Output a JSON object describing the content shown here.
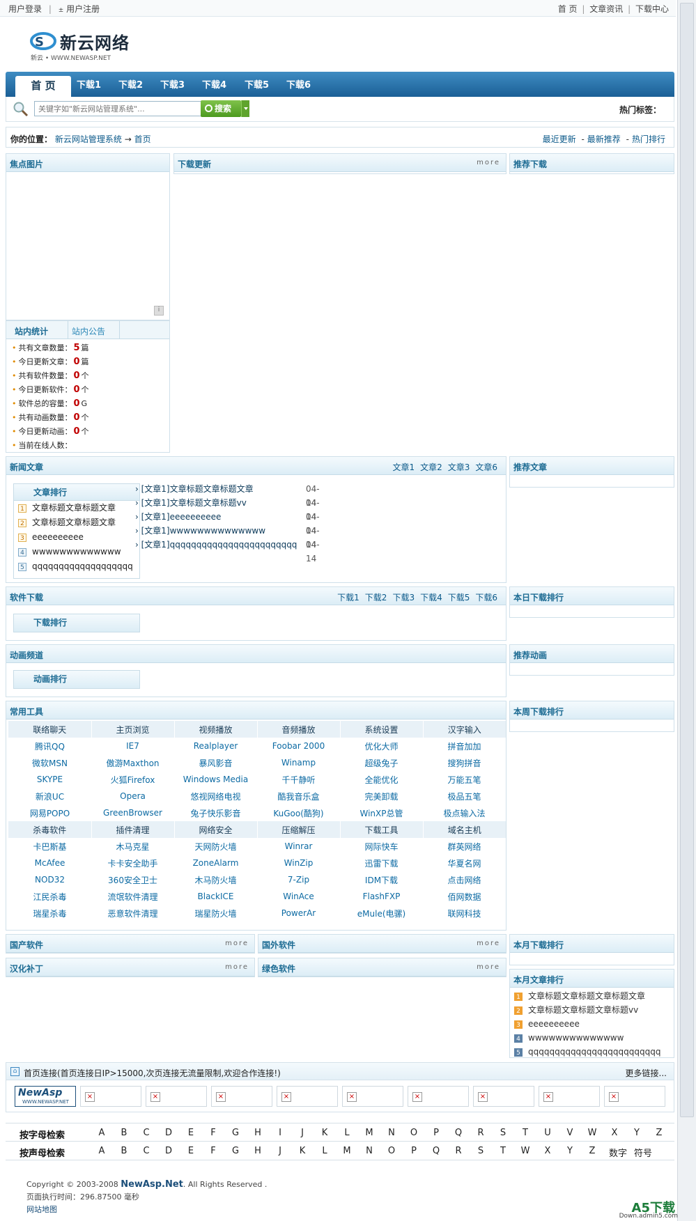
{
  "topbar": {
    "login": "用户登录",
    "register": "用户注册",
    "right": [
      "首 页",
      "文章资讯",
      "下载中心"
    ]
  },
  "logo": {
    "title": "新云网络",
    "sub": "新云 • WWW.NEWASP.NET"
  },
  "nav": {
    "home": "首 页",
    "tabs": [
      "下载1",
      "下载2",
      "下载3",
      "下载4",
      "下载5",
      "下载6"
    ]
  },
  "search": {
    "placeholder": "关键字如\"新云网站管理系统\"...",
    "button": "搜索",
    "hot": "热门标签："
  },
  "crumb": {
    "label": "你的位置：",
    "path": "新云网站管理系统",
    "arrow": "→",
    "current": "首页",
    "right": [
      "最近更新",
      "最新推荐",
      "热门排行"
    ]
  },
  "panels": {
    "focus": "焦点图片",
    "dl_update": "下载更新",
    "recommend_dl": "推荐下载",
    "more": "more",
    "stat_tab": "站内统计",
    "notice_tab": "站内公告",
    "news": "新闻文章",
    "rec_article": "推荐文章",
    "software": "软件下载",
    "today_rank": "本日下载排行",
    "anim": "动画频道",
    "rec_anim": "推荐动画",
    "tools": "常用工具",
    "week_rank": "本周下载排行",
    "domestic": "国产软件",
    "foreign": "国外软件",
    "month_rank": "本月下载排行",
    "hanhua": "汉化补丁",
    "green": "绿色软件",
    "month_article": "本月文章排行",
    "article_rank": "文章排行",
    "dl_rank": "下载排行",
    "anim_rank": "动画排行"
  },
  "stats": [
    {
      "label": "共有文章数量：",
      "value": "5",
      "unit": "篇"
    },
    {
      "label": "今日更新文章：",
      "value": "0",
      "unit": "篇"
    },
    {
      "label": "共有软件数量：",
      "value": "0",
      "unit": "个"
    },
    {
      "label": "今日更新软件：",
      "value": "0",
      "unit": "个"
    },
    {
      "label": "软件总的容量：",
      "value": "0",
      "unit": "G"
    },
    {
      "label": "共有动画数量：",
      "value": "0",
      "unit": "个"
    },
    {
      "label": "今日更新动画：",
      "value": "0",
      "unit": "个"
    },
    {
      "label": "当前在线人数：",
      "value": "",
      "unit": ""
    }
  ],
  "news_links": [
    "文章1",
    "文章2",
    "文章3",
    "文章6"
  ],
  "article_rank": [
    "文章标题文章标题文章",
    "文章标题文章标题文章",
    "eeeeeeeeee",
    "wwwwwwwwwwwww",
    "qqqqqqqqqqqqqqqqqqq"
  ],
  "news_list": [
    {
      "t": "› [文章1]文章标题文章标题文章",
      "d": "04-14"
    },
    {
      "t": "› [文章1]文章标题文章标题vv",
      "d": "04-14"
    },
    {
      "t": "› [文章1]eeeeeeeeee",
      "d": "04-14"
    },
    {
      "t": "› [文章1]wwwwwwwwwwwwww",
      "d": "04-14"
    },
    {
      "t": "› [文章1]qqqqqqqqqqqqqqqqqqqqqqqq",
      "d": "04-14"
    }
  ],
  "soft_links": [
    "下载1",
    "下载2",
    "下载3",
    "下载4",
    "下载5",
    "下载6"
  ],
  "tools": {
    "h1": [
      "联络聊天",
      "主页浏览",
      "视频播放",
      "音频播放",
      "系统设置",
      "汉字输入"
    ],
    "r1": [
      [
        "腾讯QQ",
        "IE7",
        "Realplayer",
        "Foobar 2000",
        "优化大师",
        "拼音加加"
      ],
      [
        "微软MSN",
        "傲游Maxthon",
        "暴风影音",
        "Winamp",
        "超级兔子",
        "搜狗拼音"
      ],
      [
        "SKYPE",
        "火狐Firefox",
        "Windows Media",
        "千千静听",
        "全能优化",
        "万能五笔"
      ],
      [
        "新浪UC",
        "Opera",
        "悠视网络电视",
        "酷我音乐盒",
        "完美卸载",
        "极品五笔"
      ],
      [
        "网易POPO",
        "GreenBrowser",
        "兔子快乐影音",
        "KuGoo(酷狗)",
        "WinXP总管",
        "极点输入法"
      ]
    ],
    "h2": [
      "杀毒软件",
      "插件清理",
      "网络安全",
      "压缩解压",
      "下载工具",
      "域名主机"
    ],
    "r2": [
      [
        "卡巴斯基",
        "木马克星",
        "天网防火墙",
        "Winrar",
        "网际快车",
        "群英网络"
      ],
      [
        "McAfee",
        "卡卡安全助手",
        "ZoneAlarm",
        "WinZip",
        "迅雷下载",
        "华夏名网"
      ],
      [
        "NOD32",
        "360安全卫士",
        "木马防火墙",
        "7-Zip",
        "IDM下载",
        "点击网络"
      ],
      [
        "江民杀毒",
        "流氓软件清理",
        "BlackICE",
        "WinAce",
        "FlashFXP",
        "佰网数据"
      ],
      [
        "瑞星杀毒",
        "恶意软件清理",
        "瑞星防火墙",
        "PowerAr",
        "eMule(电骡)",
        "联网科技"
      ]
    ]
  },
  "month_article": [
    "文章标题文章标题文章标题文章",
    "文章标题文章标题文章标题vv",
    "eeeeeeeeee",
    "wwwwwwwwwwwwww",
    "qqqqqqqqqqqqqqqqqqqqqqqqq"
  ],
  "friend": {
    "title": "首页连接(首页连接日IP>15000,次页连接无流量限制,欢迎合作连接!)",
    "more": "更多链接...",
    "logo_text": "NewAsp",
    "logo_sub": "WWW.NEWASP.NET"
  },
  "alpha1": {
    "label": "按字母检索",
    "letters": [
      "A",
      "B",
      "C",
      "D",
      "E",
      "F",
      "G",
      "H",
      "I",
      "J",
      "K",
      "L",
      "M",
      "N",
      "O",
      "P",
      "Q",
      "R",
      "S",
      "T",
      "U",
      "V",
      "W",
      "X",
      "Y",
      "Z"
    ]
  },
  "alpha2": {
    "label": "按声母检索",
    "letters": [
      "A",
      "B",
      "C",
      "D",
      "E",
      "F",
      "G",
      "H",
      "J",
      "K",
      "L",
      "M",
      "N",
      "O",
      "P",
      "Q",
      "R",
      "S",
      "T",
      "W",
      "X",
      "Y",
      "Z",
      "数字",
      "符号"
    ]
  },
  "footer": {
    "copy": "Copyright © 2003-2008 ",
    "brand": "NewAsp.Net",
    "rights": ". All Rights Reserved .",
    "time": "页面执行时间：296.87500 毫秒",
    "map": "网站地图"
  },
  "watermark": {
    "main": "A5下载",
    "sub": "Down.admin5.com"
  }
}
